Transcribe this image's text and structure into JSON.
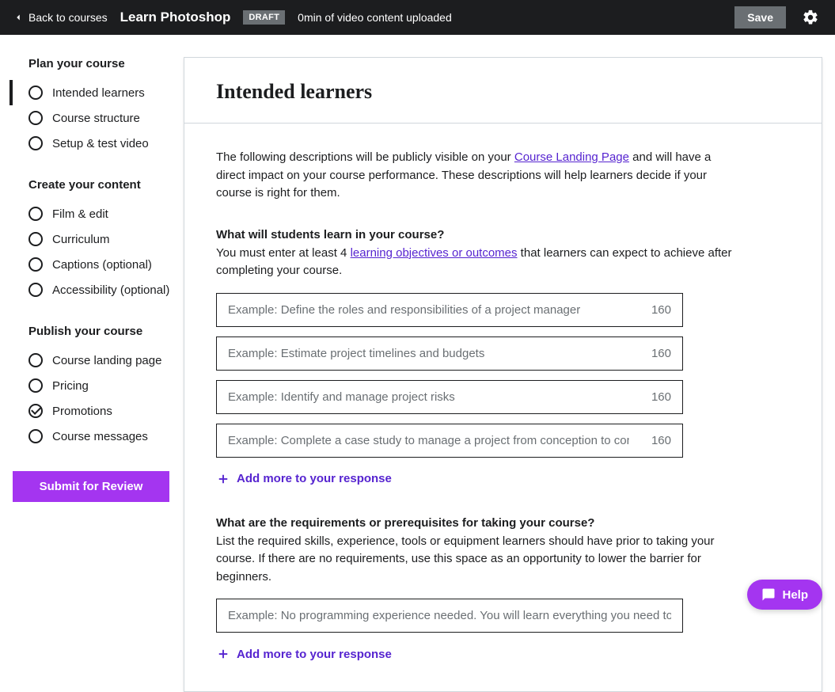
{
  "topbar": {
    "back_label": "Back to courses",
    "course_title": "Learn Photoshop",
    "draft_badge": "DRAFT",
    "upload_status": "0min of video content uploaded",
    "save_label": "Save"
  },
  "sidebar": {
    "sections": [
      {
        "title": "Plan your course",
        "items": [
          {
            "label": "Intended learners",
            "active": true,
            "checked": false
          },
          {
            "label": "Course structure",
            "active": false,
            "checked": false
          },
          {
            "label": "Setup & test video",
            "active": false,
            "checked": false
          }
        ]
      },
      {
        "title": "Create your content",
        "items": [
          {
            "label": "Film & edit",
            "active": false,
            "checked": false
          },
          {
            "label": "Curriculum",
            "active": false,
            "checked": false
          },
          {
            "label": "Captions (optional)",
            "active": false,
            "checked": false
          },
          {
            "label": "Accessibility (optional)",
            "active": false,
            "checked": false
          }
        ]
      },
      {
        "title": "Publish your course",
        "items": [
          {
            "label": "Course landing page",
            "active": false,
            "checked": false
          },
          {
            "label": "Pricing",
            "active": false,
            "checked": false
          },
          {
            "label": "Promotions",
            "active": false,
            "checked": true
          },
          {
            "label": "Course messages",
            "active": false,
            "checked": false
          }
        ]
      }
    ],
    "submit_label": "Submit for Review"
  },
  "main": {
    "title": "Intended learners",
    "intro_before": "The following descriptions will be publicly visible on your ",
    "intro_link": "Course Landing Page",
    "intro_after": " and will have a direct impact on your course performance. These descriptions will help learners decide if your course is right for them.",
    "objectives": {
      "label": "What will students learn in your course?",
      "help_before": "You must enter at least 4 ",
      "help_link": "learning objectives or outcomes",
      "help_after": " that learners can expect to achieve after completing your course.",
      "inputs": [
        {
          "placeholder": "Example: Define the roles and responsibilities of a project manager",
          "count": "160"
        },
        {
          "placeholder": "Example: Estimate project timelines and budgets",
          "count": "160"
        },
        {
          "placeholder": "Example: Identify and manage project risks",
          "count": "160"
        },
        {
          "placeholder": "Example: Complete a case study to manage a project from conception to completion",
          "count": "160"
        }
      ],
      "add_more": "Add more to your response"
    },
    "requirements": {
      "label": "What are the requirements or prerequisites for taking your course?",
      "help": "List the required skills, experience, tools or equipment learners should have prior to taking your course. If there are no requirements, use this space as an opportunity to lower the barrier for beginners.",
      "inputs": [
        {
          "placeholder": "Example: No programming experience needed. You will learn everything you need to know"
        }
      ],
      "add_more": "Add more to your response"
    }
  },
  "help_fab": "Help"
}
